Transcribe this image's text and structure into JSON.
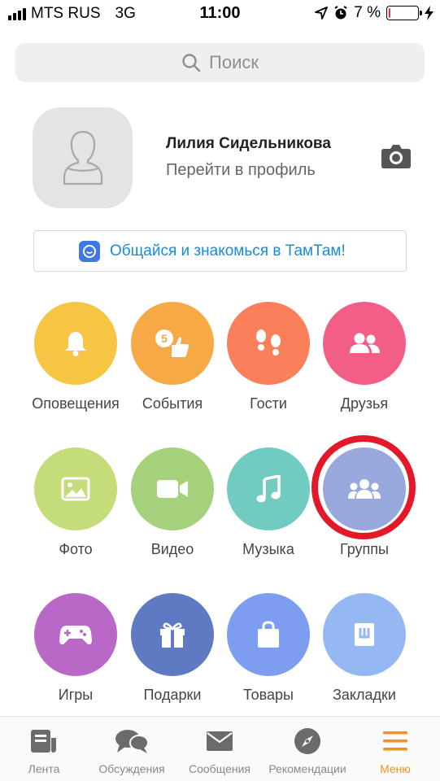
{
  "status_bar": {
    "carrier": "MTS RUS",
    "network": "3G",
    "time": "11:00",
    "battery": "7 %",
    "battery_level": 0.07,
    "icons": [
      "signal-icon",
      "location-arrow-icon",
      "alarm-icon",
      "battery-icon",
      "charging-bolt-icon"
    ]
  },
  "search": {
    "placeholder": "Поиск"
  },
  "profile": {
    "name": "Лилия Сидельникова",
    "link": "Перейти в профиль"
  },
  "banner": {
    "text": "Общайся и знакомься в ТамТам!"
  },
  "grid": [
    {
      "label": "Оповещения",
      "icon": "bell-icon",
      "color": "#f6c543"
    },
    {
      "label": "События",
      "icon": "thumbs-up-icon",
      "color": "#f7a946",
      "badge": "5"
    },
    {
      "label": "Гости",
      "icon": "footprints-icon",
      "color": "#fb7f5a"
    },
    {
      "label": "Друзья",
      "icon": "friends-icon",
      "color": "#f25e85"
    },
    {
      "label": "Фото",
      "icon": "photo-icon",
      "color": "#c5dc7a"
    },
    {
      "label": "Видео",
      "icon": "video-camera-icon",
      "color": "#a5d17c"
    },
    {
      "label": "Музыка",
      "icon": "music-note-icon",
      "color": "#71cbc1"
    },
    {
      "label": "Группы",
      "icon": "groups-icon",
      "color": "#98a8dc"
    },
    {
      "label": "Игры",
      "icon": "gamepad-icon",
      "color": "#b968c8"
    },
    {
      "label": "Подарки",
      "icon": "gift-icon",
      "color": "#5f7ac2"
    },
    {
      "label": "Товары",
      "icon": "shopping-bag-icon",
      "color": "#7d9df0"
    },
    {
      "label": "Закладки",
      "icon": "bookmark-icon",
      "color": "#96b8f2"
    }
  ],
  "highlight_color": "#e3192a",
  "bottom_nav": [
    {
      "label": "Лента",
      "icon": "feed-icon"
    },
    {
      "label": "Обсуждения",
      "icon": "discussions-icon"
    },
    {
      "label": "Сообщения",
      "icon": "envelope-icon"
    },
    {
      "label": "Рекомендации",
      "icon": "compass-icon"
    },
    {
      "label": "Меню",
      "icon": "menu-icon",
      "active": true
    }
  ],
  "accent_color": "#f5921e"
}
